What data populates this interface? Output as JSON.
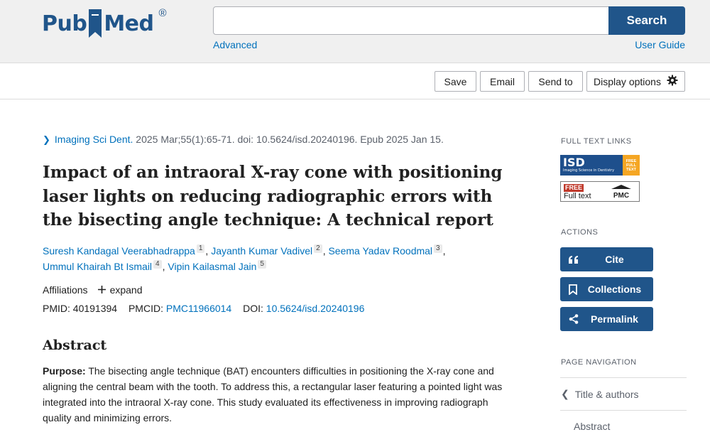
{
  "header": {
    "logo_text_left": "Pub",
    "logo_text_right": "Med",
    "logo_registered": "®",
    "search_value": "",
    "search_button": "Search",
    "advanced_link": "Advanced",
    "user_guide_link": "User Guide"
  },
  "toolbar": {
    "save": "Save",
    "email": "Email",
    "send_to": "Send to",
    "display_options": "Display options"
  },
  "article": {
    "journal": "Imaging Sci Dent.",
    "citation_rest": " 2025 Mar;55(1):65-71. doi: 10.5624/isd.20240196. Epub 2025 Jan 15.",
    "title": "Impact of an intraoral X-ray cone with positioning laser lights on reducing radiographic errors with the bisecting angle technique: A technical report",
    "authors": [
      {
        "name": "Suresh Kandagal Veerabhadrappa",
        "aff": "1"
      },
      {
        "name": "Jayanth Kumar Vadivel",
        "aff": "2"
      },
      {
        "name": "Seema Yadav Roodmal",
        "aff": "3"
      },
      {
        "name": "Ummul Khairah Bt Ismail",
        "aff": "4"
      },
      {
        "name": "Vipin Kailasmal Jain",
        "aff": "5"
      }
    ],
    "affiliations_label": "Affiliations",
    "expand_label": "expand",
    "pmid_label": "PMID: ",
    "pmid": "40191394",
    "pmcid_label": "PMCID: ",
    "pmcid": "PMC11966014",
    "doi_label": "DOI: ",
    "doi": "10.5624/isd.20240196",
    "abstract_heading": "Abstract",
    "abstract_purpose_label": "Purpose:",
    "abstract_purpose_text": " The bisecting angle technique (BAT) encounters difficulties in positioning the X-ray cone and aligning the central beam with the tooth. To address this, a rectangular laser featuring a pointed light was integrated into the intraoral X-ray cone. This study evaluated its effectiveness in improving radiograph quality and minimizing errors."
  },
  "sidebar": {
    "full_text_links_heading": "FULL TEXT LINKS",
    "isd_big": "ISD",
    "isd_small": "Imaging Science in Dentistry",
    "isd_free": "FREE FULL TEXT",
    "pmc_free": "FREE",
    "pmc_full_text": "Full text",
    "pmc_label": "PMC",
    "actions_heading": "ACTIONS",
    "cite": "Cite",
    "collections": "Collections",
    "permalink": "Permalink",
    "page_nav_heading": "PAGE NAVIGATION",
    "nav_title_authors": "Title & authors",
    "nav_abstract": "Abstract"
  },
  "colors": {
    "brand_blue": "#20558a",
    "link_blue": "#0071bc",
    "header_bg": "#f0f0f0"
  }
}
